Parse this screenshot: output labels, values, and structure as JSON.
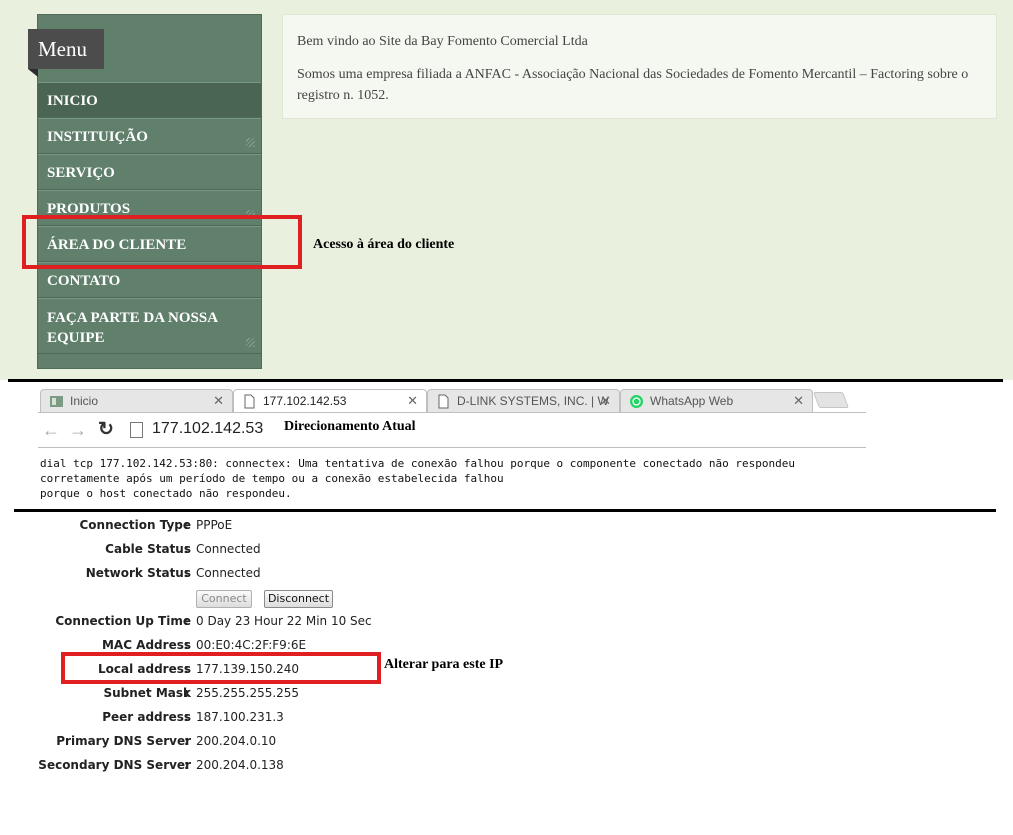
{
  "site": {
    "menu_title": "Menu",
    "menu_items": [
      {
        "label": "INICIO",
        "active": true
      },
      {
        "label": "INSTITUIÇÃO"
      },
      {
        "label": "SERVIÇO"
      },
      {
        "label": "PRODUTOS"
      },
      {
        "label": "ÁREA DO CLIENTE"
      },
      {
        "label": "CONTATO"
      },
      {
        "label": "FAÇA PARTE DA NOSSA EQUIPE"
      }
    ],
    "welcome_title": "Bem vindo ao Site da Bay Fomento Comercial Ltda",
    "welcome_body": "Somos uma empresa filiada a ANFAC - Associação Nacional das Sociedades de Fomento Mercantil – Factoring sobre o registro n. 1052."
  },
  "annotations": {
    "client_area": "Acesso à área do cliente",
    "current_redirect": "Direcionamento Atual",
    "change_ip": "Alterar para este IP",
    "highlight_color": "#e02020"
  },
  "browser": {
    "tabs": [
      {
        "title": "Inicio",
        "icon": "site-favicon"
      },
      {
        "title": "177.102.142.53",
        "icon": "page-icon",
        "active": true
      },
      {
        "title": "D-LINK SYSTEMS, INC. | W",
        "icon": "page-icon"
      },
      {
        "title": "WhatsApp Web",
        "icon": "whatsapp-icon"
      }
    ],
    "address": "177.102.142.53",
    "error_message": "dial tcp 177.102.142.53:80: connectex: Uma tentativa de conexão falhou porque o componente conectado não respondeu\ncorretamente após um período de tempo ou a conexão estabelecida falhou\nporque o host conectado não respondeu."
  },
  "router": {
    "status": [
      {
        "label": "Connection Type",
        "value": "PPPoE"
      },
      {
        "label": "Cable Status",
        "value": "Connected"
      },
      {
        "label": "Network Status",
        "value": "Connected"
      },
      {
        "label": "Connection Up Time",
        "value": "0 Day 23 Hour 22 Min 10 Sec"
      },
      {
        "label": "MAC Address",
        "value": "00:E0:4C:2F:F9:6E"
      },
      {
        "label": "Local address",
        "value": "177.139.150.240"
      },
      {
        "label": "Subnet Mask",
        "value": "255.255.255.255"
      },
      {
        "label": "Peer address",
        "value": "187.100.231.3"
      },
      {
        "label": "Primary DNS Server",
        "value": "200.204.0.10"
      },
      {
        "label": "Secondary DNS Server",
        "value": "200.204.0.138"
      }
    ],
    "connect_label": "Connect",
    "disconnect_label": "Disconnect"
  }
}
